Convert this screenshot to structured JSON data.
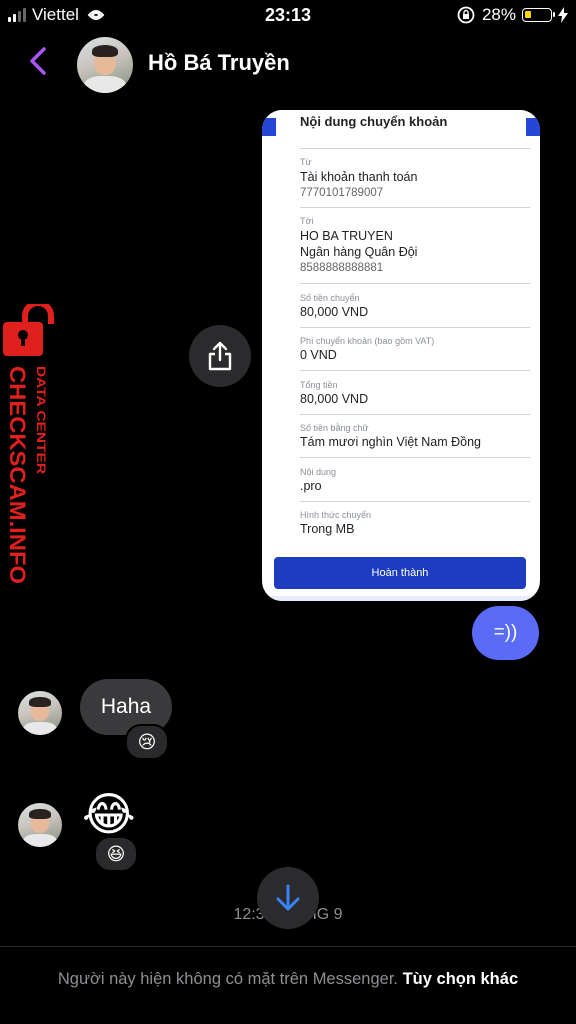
{
  "status_bar": {
    "carrier": "Viettel",
    "time": "23:13",
    "battery": "28%",
    "battery_level": 0.28
  },
  "header": {
    "contact_name": "Hồ Bá Truyền",
    "back_icon": "chevron-left-icon"
  },
  "receipt": {
    "title": "Nội dung chuyển khoản",
    "from_label": "Từ",
    "from_account_name": "Tài khoản thanh toán",
    "from_account_number": "7770101789007",
    "to_label": "Tới",
    "to_name": "HO BA TRUYEN",
    "to_bank": "Ngân hàng Quân Đội",
    "to_account_number": "8588888888881",
    "amount_label": "Số tiền chuyển",
    "amount_value": "80,000 VND",
    "fee_label": "Phí chuyển khoản (bao gồm VAT)",
    "fee_value": "0 VND",
    "total_label": "Tổng tiền",
    "total_value": "80,000 VND",
    "words_label": "Số tiền bằng chữ",
    "words_value": "Tám mươi nghìn Việt Nam Đồng",
    "content_label": "Nội dung",
    "content_value": ".pro",
    "method_label": "Hình thức chuyển",
    "method_value": "Trong MB",
    "done_button": "Hoàn thành"
  },
  "watermark": {
    "brand": "CHECKSCAM.INFO",
    "subtitle": "DATA CENTER",
    "accent": "#e0201c"
  },
  "messages": {
    "outgoing_text": "=))",
    "incoming_text": "Haha",
    "incoming_reaction": "😢",
    "incoming_emoji": "😂",
    "emoji_reaction": "😆"
  },
  "timestamp": "12:35, 7 THG 9",
  "footer": {
    "notice": "Người này hiện không có mặt trên Messenger.",
    "link": "Tùy chọn khác"
  },
  "colors": {
    "accent_purple": "#a855f7",
    "outgoing_bubble": "#5a6bf5",
    "bank_blue": "#1e3cc0"
  }
}
